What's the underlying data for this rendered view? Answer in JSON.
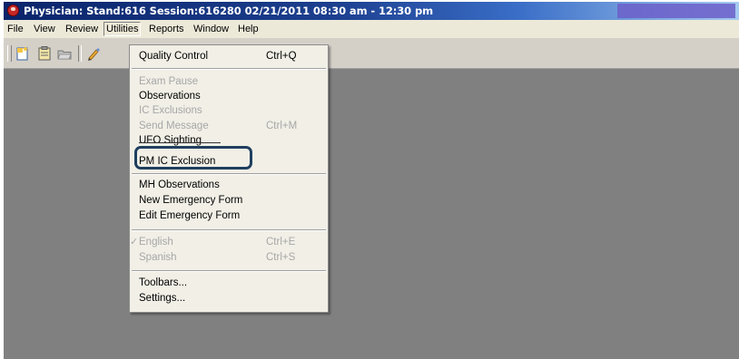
{
  "window": {
    "title": "Physician: Stand:616 Session:616280 02/21/2011 08:30 am - 12:30 pm"
  },
  "menubar": {
    "items": [
      {
        "label": "File"
      },
      {
        "label": "View"
      },
      {
        "label": "Review"
      },
      {
        "label": "Utilities"
      },
      {
        "label": "Reports"
      },
      {
        "label": "Window"
      },
      {
        "label": "Help"
      }
    ]
  },
  "toolbar": {
    "buttons": [
      {
        "icon": "new-icon"
      },
      {
        "icon": "clipboard-icon"
      },
      {
        "icon": "open-folder-icon"
      },
      {
        "icon": "pen-icon"
      }
    ]
  },
  "utilities_menu": {
    "items": [
      {
        "label": "Quality Control",
        "shortcut": "Ctrl+Q",
        "enabled": true
      },
      {
        "label": "Exam Pause",
        "shortcut": "",
        "enabled": false
      },
      {
        "label": "Observations",
        "shortcut": "",
        "enabled": true
      },
      {
        "label": "IC Exclusions",
        "shortcut": "",
        "enabled": false
      },
      {
        "label": "Send Message",
        "shortcut": "Ctrl+M",
        "enabled": false
      },
      {
        "label": "UFO Sighting",
        "shortcut": "",
        "enabled": true
      },
      {
        "label": "PM IC Exclusion",
        "shortcut": "",
        "enabled": true
      },
      {
        "label": "MH Observations",
        "shortcut": "",
        "enabled": true
      },
      {
        "label": "New Emergency Form",
        "shortcut": "",
        "enabled": true
      },
      {
        "label": "Edit Emergency Form",
        "shortcut": "",
        "enabled": true
      },
      {
        "label": "English",
        "shortcut": "Ctrl+E",
        "enabled": false,
        "checked": true
      },
      {
        "label": "Spanish",
        "shortcut": "Ctrl+S",
        "enabled": false
      },
      {
        "label": "Toolbars...",
        "shortcut": "",
        "enabled": true
      },
      {
        "label": "Settings...",
        "shortcut": "",
        "enabled": true
      }
    ]
  },
  "colors": {
    "titlebar": "#0a246a",
    "workspace": "#808080",
    "highlight_border": "#1f3f5f"
  }
}
